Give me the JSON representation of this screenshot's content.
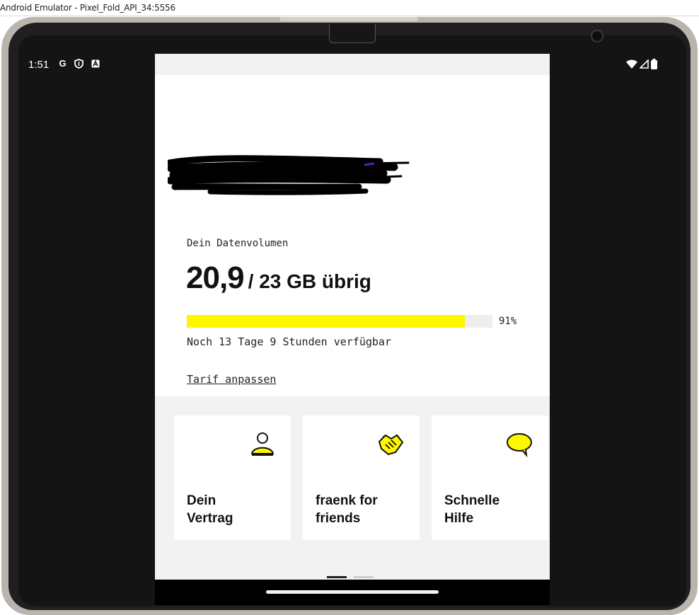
{
  "window": {
    "title": "Android Emulator - Pixel_Fold_API_34:5556"
  },
  "status_bar": {
    "time": "1:51",
    "left_icons": [
      "google-icon",
      "shield-icon",
      "a-icon"
    ],
    "left_glyphs": [
      "G",
      "⛉",
      "A"
    ],
    "right_icons": [
      "wifi-icon",
      "signal-icon",
      "battery-icon"
    ]
  },
  "data_card": {
    "label": "Dein Datenvolumen",
    "remaining_value": "20,9",
    "total_text": "/ 23 GB übrig",
    "usage_percent": 91,
    "percent_text": "91%",
    "remaining_time": "Noch 13 Tage 9 Stunden verfügbar",
    "link": "Tarif anpassen",
    "accent_color": "#fff700"
  },
  "tiles": [
    {
      "line1": "Dein",
      "line2": "Vertrag",
      "icon": "person-icon"
    },
    {
      "line1": "fraenk for",
      "line2": "friends",
      "icon": "handshake-icon"
    },
    {
      "line1": "Schnelle",
      "line2": "Hilfe",
      "icon": "chat-bubble-icon"
    }
  ],
  "pager": {
    "pages": 2,
    "active": 0
  }
}
